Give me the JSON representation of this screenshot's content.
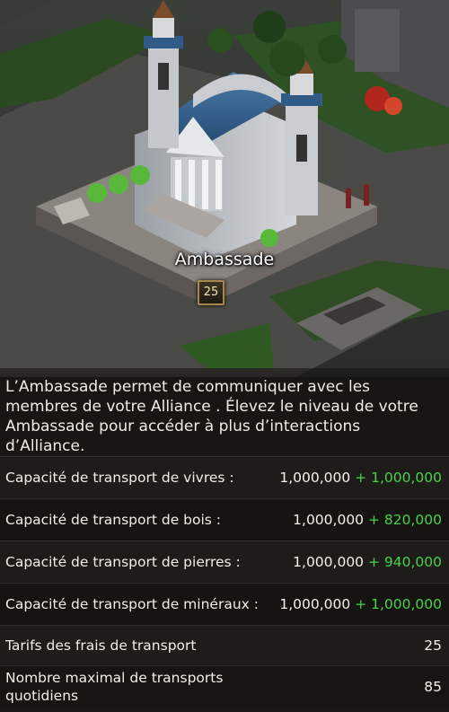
{
  "building": {
    "name": "Ambassade",
    "level": "25"
  },
  "description": "L’Ambassade permet de communiquer avec les membres de votre Alliance . Élevez le niveau de votre Ambassade pour accéder à plus d’interactions d’Alliance.",
  "stats": [
    {
      "label": "Capacité de transport de vivres :",
      "base": "1,000,000",
      "bonus": "+ 1,000,000"
    },
    {
      "label": "Capacité de transport de bois :",
      "base": "1,000,000",
      "bonus": "+ 820,000"
    },
    {
      "label": "Capacité de transport de pierres :",
      "base": "1,000,000",
      "bonus": "+ 940,000"
    },
    {
      "label": "Capacité de transport de minéraux :",
      "base": "1,000,000",
      "bonus": "+ 1,000,000"
    },
    {
      "label": "Tarifs des frais de transport",
      "base": "25",
      "bonus": ""
    },
    {
      "label": "Nombre maximal de transports quotidiens",
      "base": "85",
      "bonus": ""
    }
  ],
  "colors": {
    "bonus": "#49d24a",
    "text": "#f0ede4",
    "panel": "#1c1a16"
  }
}
